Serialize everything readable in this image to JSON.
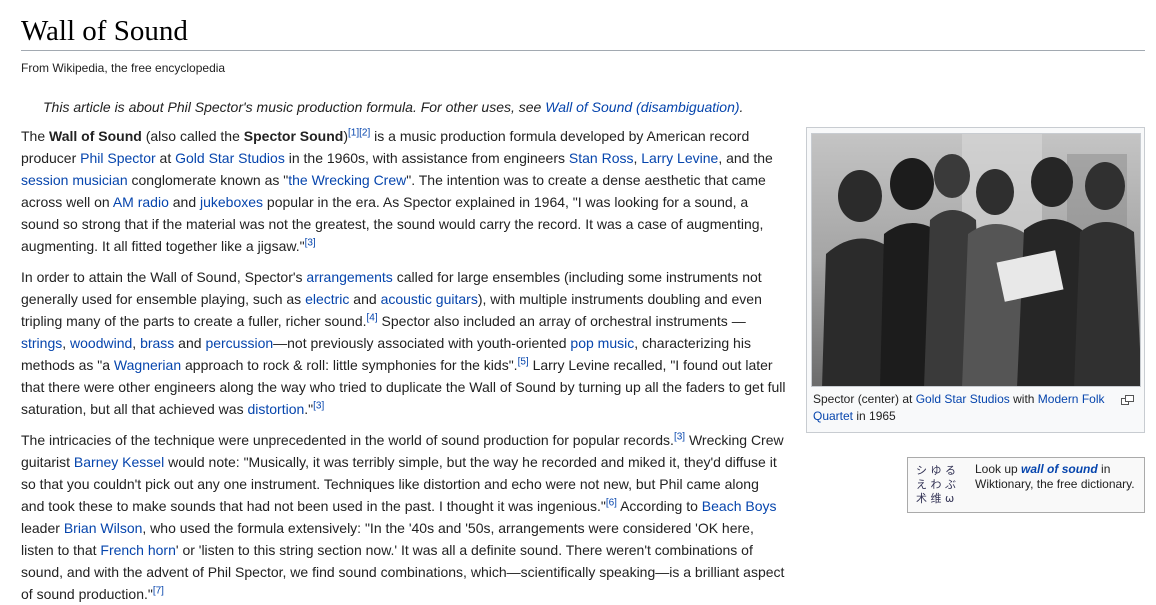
{
  "title": "Wall of Sound",
  "tagline": "From Wikipedia, the free encyclopedia",
  "hatnote": {
    "text": "This article is about Phil Spector's music production formula. For other uses, see ",
    "link": "Wall of Sound (disambiguation)",
    "end": "."
  },
  "thumb": {
    "caption_pre": "Spector (center) at ",
    "caption_link1": "Gold Star Studios",
    "caption_mid": " with ",
    "caption_link2": "Modern Folk Quartet",
    "caption_post": " in 1965",
    "enlarge_icon": "enlarge-icon"
  },
  "wiktionary": {
    "logo_glyphs": "シ ゆ る\nえ わ ぶ\n术 维 ω",
    "pre": "Look up ",
    "term": "wall of sound",
    "post": " in Wiktionary, the free dictionary."
  },
  "p1": {
    "s1": "The ",
    "b1": "Wall of Sound",
    "s2": " (also called the ",
    "b2": "Spector Sound",
    "s3": ")",
    "r1": "[1]",
    "r2": "[2]",
    "s4": " is a music production formula developed by American record producer ",
    "l1": "Phil Spector",
    "s5": " at ",
    "l2": "Gold Star Studios",
    "s6": " in the 1960s, with assistance from engineers ",
    "l3": "Stan Ross",
    "s7": ", ",
    "l4": "Larry Levine",
    "s8": ", and the ",
    "l5": "session musician",
    "s9": " conglomerate known as \"",
    "l6": "the Wrecking Crew",
    "s10": "\". The intention was to create a dense aesthetic that came across well on ",
    "l7": "AM radio",
    "s11": " and ",
    "l8": "jukeboxes",
    "s12": " popular in the era. As Spector explained in 1964, \"I was looking for a sound, a sound so strong that if the material was not the greatest, the sound would carry the record. It was a case of augmenting, augmenting. It all fitted together like a jigsaw.\"",
    "r3": "[3]"
  },
  "p2": {
    "s1": "In order to attain the Wall of Sound, Spector's ",
    "l1": "arrangements",
    "s2": " called for large ensembles (including some instruments not generally used for ensemble playing, such as ",
    "l2": "electric",
    "s3": " and ",
    "l3": "acoustic guitars",
    "s4": "), with multiple instruments doubling and even tripling many of the parts to create a fuller, richer sound.",
    "r4": "[4]",
    "s5": " Spector also included an array of orchestral instruments —",
    "l4": "strings",
    "s6": ", ",
    "l5": "woodwind",
    "s7": ", ",
    "l6": "brass",
    "s8": " and ",
    "l7": "percussion",
    "s9": "—not previously associated with youth-oriented ",
    "l8": "pop music",
    "s10": ", characterizing his methods as \"a ",
    "l9": "Wagnerian",
    "s11": " approach to rock & roll: little symphonies for the kids\".",
    "r5": "[5]",
    "s12": " Larry Levine recalled, \"I found out later that there were other engineers along the way who tried to duplicate the Wall of Sound by turning up all the faders to get full saturation, but all that achieved was ",
    "l10": "distortion",
    "s13": ".\"",
    "r6": "[3]"
  },
  "p3": {
    "s1": "The intricacies of the technique were unprecedented in the world of sound production for popular records.",
    "r1": "[3]",
    "s2": " Wrecking Crew guitarist ",
    "l1": "Barney Kessel",
    "s3": " would note: \"Musically, it was terribly simple, but the way he recorded and miked it, they'd diffuse it so that you couldn't pick out any one instrument. Techniques like distortion and echo were not new, but Phil came along and took these to make sounds that had not been used in the past. I thought it was ingenious.\"",
    "r2": "[6]",
    "s4": " According to ",
    "l2": "Beach Boys",
    "s5": " leader ",
    "l3": "Brian Wilson",
    "s6": ", who used the formula extensively: \"In the '40s and '50s, arrangements were considered 'OK here, listen to that ",
    "l4": "French horn",
    "s7": "' or 'listen to this string section now.' It was all a definite sound. There weren't combinations of sound, and with the advent of Phil Spector, we find sound combinations, which—scientifically speaking—is a brilliant aspect of sound production.\"",
    "r3": "[7]"
  }
}
